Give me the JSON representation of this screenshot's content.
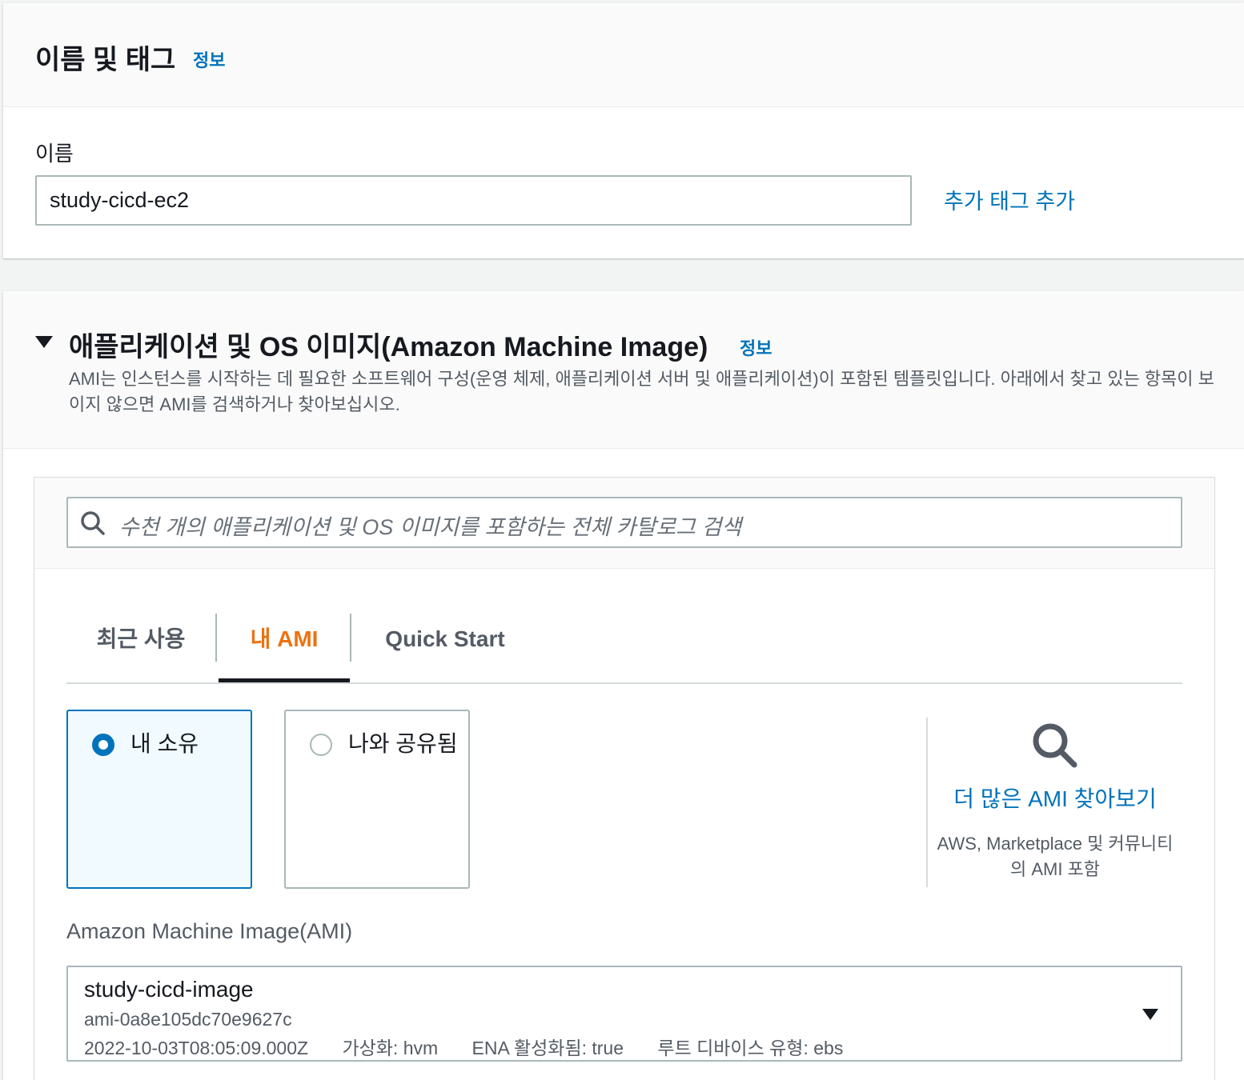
{
  "name_tags": {
    "title": "이름 및 태그",
    "info_link": "정보",
    "name_label": "이름",
    "name_value": "study-cicd-ec2",
    "add_tag": "추가 태그 추가"
  },
  "ami_section": {
    "title": "애플리케이션 및 OS 이미지(Amazon Machine Image)",
    "info_link": "정보",
    "description": "AMI는 인스턴스를 시작하는 데 필요한 소프트웨어 구성(운영 체제, 애플리케이션 서버 및 애플리케이션)이 포함된 템플릿입니다. 아래에서 찾고 있는 항목이 보이지 않으면 AMI를 검색하거나 찾아보십시오.",
    "search_placeholder": "수천 개의 애플리케이션 및 OS 이미지를 포함하는 전체 카탈로그 검색",
    "tabs": [
      {
        "label": "최근 사용",
        "active": false
      },
      {
        "label": "내 AMI",
        "active": true
      },
      {
        "label": "Quick Start",
        "active": false
      }
    ],
    "radio_options": [
      {
        "label": "내 소유",
        "selected": true
      },
      {
        "label": "나와 공유됨",
        "selected": false
      }
    ],
    "browse": {
      "link": "더 많은 AMI 찾아보기",
      "subtext": "AWS, Marketplace 및 커뮤니티의 AMI 포함"
    },
    "ami_label": "Amazon Machine Image(AMI)",
    "selected_ami": {
      "name": "study-cicd-image",
      "id": "ami-0a8e105dc70e9627c",
      "created": "2022-10-03T08:05:09.000Z",
      "virtualization": "가상화: hvm",
      "ena": "ENA 활성화됨: true",
      "root_device": "루트 디바이스 유형: ebs"
    }
  },
  "colors": {
    "link": "#0073bb",
    "active_tab": "#ec7211",
    "background": "#f2f3f3"
  }
}
